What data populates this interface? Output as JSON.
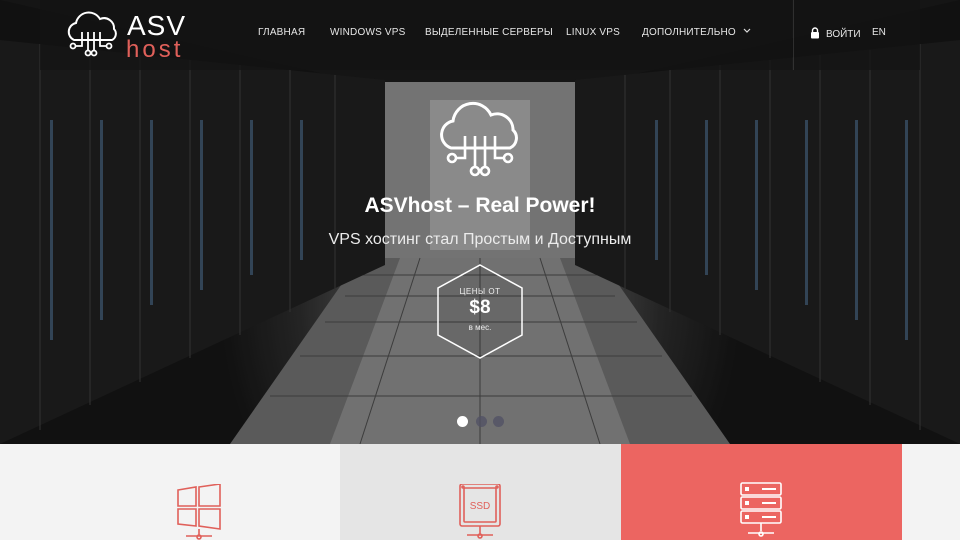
{
  "brand": {
    "name_top": "ASV",
    "name_bottom": "host"
  },
  "nav": {
    "items": [
      {
        "label": "ГЛАВНАЯ"
      },
      {
        "label": "WINDOWS VPS"
      },
      {
        "label": "ВЫДЕЛЕННЫЕ СЕРВЕРЫ"
      },
      {
        "label": "LINUX VPS"
      },
      {
        "label": "ДОПОЛНИТЕЛЬНО"
      }
    ],
    "login_label": "ВОЙТИ",
    "lang_label": "EN"
  },
  "hero": {
    "title": "ASVhost – Real Power!",
    "subtitle": "VPS хостинг стал Простым и Доступным",
    "price_caption": "ЦЕНЫ ОТ",
    "price_value": "$8",
    "price_period": "в мес.",
    "slides_total": 3,
    "slide_active": 1
  },
  "features": [
    {
      "icon": "windows-icon"
    },
    {
      "icon": "ssd-icon",
      "label": "SSD"
    },
    {
      "icon": "server-rack-icon"
    }
  ],
  "colors": {
    "accent": "#ec6561",
    "nav_bg": "#141414",
    "logo_host": "#e0605a"
  }
}
